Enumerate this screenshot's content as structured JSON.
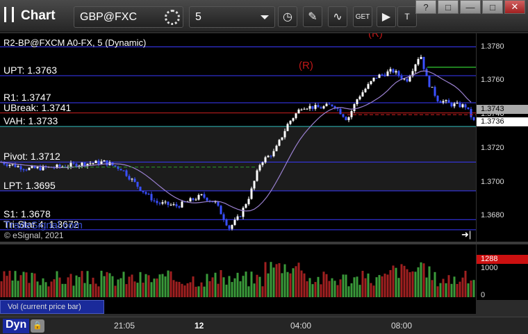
{
  "window": {
    "title": "Chart",
    "symbol": "GBP@FXC",
    "interval": "5",
    "controls": [
      "?",
      "□",
      "—",
      "□",
      "✕"
    ]
  },
  "legend": {
    "study_line": "R2-BP@FXCM A0-FX, 5 (Dynamic)",
    "watermark": "TradeSignal.com",
    "copyright": "© eSignal, 2021"
  },
  "levels": [
    {
      "name": "UPT",
      "text": "UPT: 1.3763",
      "price": 1.3763,
      "color": "#3a3aff"
    },
    {
      "name": "R1",
      "text": "R1: 1.3747",
      "price": 1.3747,
      "color": "#3a3aff"
    },
    {
      "name": "UBreak",
      "text": "UBreak: 1.3741",
      "price": 1.3741,
      "color": "#cc2020"
    },
    {
      "name": "VAH",
      "text": "VAH: 1.3733",
      "price": 1.3733,
      "color": "#30c0c0"
    },
    {
      "name": "Pivot",
      "text": "Pivot: 1.3712",
      "price": 1.3712,
      "color": "#3a3aff"
    },
    {
      "name": "LPT",
      "text": "LPT: 1.3695",
      "price": 1.3695,
      "color": "#3a3aff"
    },
    {
      "name": "S1",
      "text": "S1: 1.3678",
      "price": 1.3678,
      "color": "#3a3aff"
    },
    {
      "name": "TriStar",
      "text": "Tri-Star 4: 1.3672",
      "price": 1.3672,
      "color": "#3a3aff"
    }
  ],
  "price_axis": {
    "ticks": [
      "1.3780",
      "1.3760",
      "1.3740",
      "1.3720",
      "1.3700",
      "1.3680"
    ],
    "tick_values": [
      1.378,
      1.376,
      1.374,
      1.372,
      1.37,
      1.368
    ],
    "last_price": "1.3743",
    "current_price": "1.3736",
    "ylim": [
      1.3665,
      1.3788
    ]
  },
  "volume_axis": {
    "ticks": [
      "1000",
      "0"
    ],
    "current_volume": "1288"
  },
  "volume_legend": "Vol (current price bar)",
  "bottom": {
    "pane_label": "Dyn",
    "time_labels": [
      "21:05",
      "12",
      "04:00",
      "08:00"
    ]
  },
  "signals": {
    "r_markers": [
      "(R)",
      "(R)"
    ]
  },
  "colors": {
    "up_bar": "#ffffff",
    "down_bar": "#3a50ff",
    "ma_line": "#9a80d0",
    "vol_up": "#3a9a3a",
    "vol_down": "#a02020",
    "level_line": "#3a3aff"
  }
}
